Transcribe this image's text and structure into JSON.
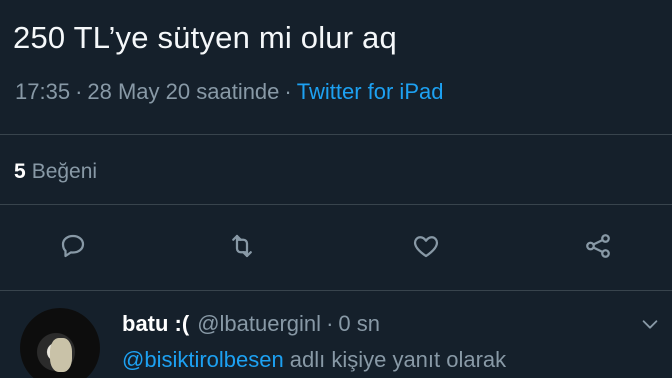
{
  "tweet": {
    "text": "250 TL’ye sütyen mi olur aq",
    "time": "17:35",
    "date": "28 May 20 saatinde",
    "separator": "·",
    "source": "Twitter for iPad"
  },
  "stats": {
    "likes_count": "5",
    "likes_label": "Beğeni"
  },
  "actions": {
    "icons": [
      "reply-icon",
      "retweet-icon",
      "like-icon",
      "share-icon"
    ]
  },
  "reply": {
    "name": "batu :(",
    "handle": "@lbatuerginl",
    "separator": "·",
    "time": "0 sn",
    "mention": "@bisiktirolbesen",
    "reply_to_label": "adlı kişiye yanıt olarak"
  },
  "colors": {
    "background": "#15202b",
    "accent": "#1da1f2",
    "muted": "#8899a6",
    "divider": "#38444d"
  }
}
